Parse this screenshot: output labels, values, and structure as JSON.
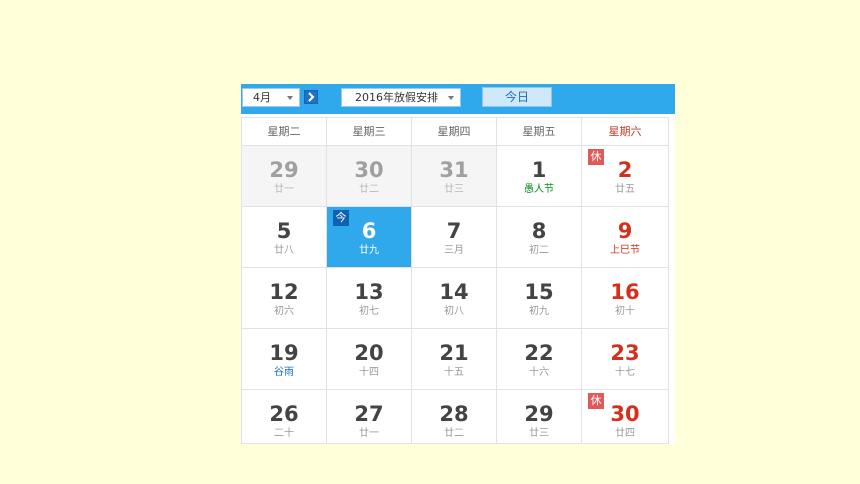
{
  "toolbar": {
    "month_value": "4月",
    "holiday_select": "2016年放假安排",
    "today_label": "今日"
  },
  "weekdays": [
    "星期二",
    "星期三",
    "星期四",
    "星期五",
    "星期六"
  ],
  "badges": {
    "rest": "休",
    "today": "今"
  },
  "weeks": [
    [
      {
        "day": "29",
        "lunar": "廿一"
      },
      {
        "day": "30",
        "lunar": "廿二"
      },
      {
        "day": "31",
        "lunar": "廿三"
      },
      {
        "day": "1",
        "lunar": "愚人节"
      },
      {
        "day": "2",
        "lunar": "廿五"
      }
    ],
    [
      {
        "day": "5",
        "lunar": "廿八"
      },
      {
        "day": "6",
        "lunar": "廿九"
      },
      {
        "day": "7",
        "lunar": "三月"
      },
      {
        "day": "8",
        "lunar": "初二"
      },
      {
        "day": "9",
        "lunar": "上巳节"
      }
    ],
    [
      {
        "day": "12",
        "lunar": "初六"
      },
      {
        "day": "13",
        "lunar": "初七"
      },
      {
        "day": "14",
        "lunar": "初八"
      },
      {
        "day": "15",
        "lunar": "初九"
      },
      {
        "day": "16",
        "lunar": "初十"
      }
    ],
    [
      {
        "day": "19",
        "lunar": "谷雨"
      },
      {
        "day": "20",
        "lunar": "十四"
      },
      {
        "day": "21",
        "lunar": "十五"
      },
      {
        "day": "22",
        "lunar": "十六"
      },
      {
        "day": "23",
        "lunar": "十七"
      }
    ],
    [
      {
        "day": "26",
        "lunar": "二十"
      },
      {
        "day": "27",
        "lunar": "廿一"
      },
      {
        "day": "28",
        "lunar": "廿二"
      },
      {
        "day": "29",
        "lunar": "廿三"
      },
      {
        "day": "30",
        "lunar": "廿四"
      }
    ]
  ],
  "colors": {
    "background": "#ffffd9",
    "toolbar": "#2fa9ec",
    "today_cell": "#2fa9ec",
    "weekend_text": "#d6301c",
    "festival_text": "#0c8b1e",
    "solar_term_text": "#1b6fb7",
    "rest_badge": "#e05a5a"
  },
  "icons": {
    "dropdown": "chevron-down-icon",
    "next": "arrow-right-icon"
  }
}
